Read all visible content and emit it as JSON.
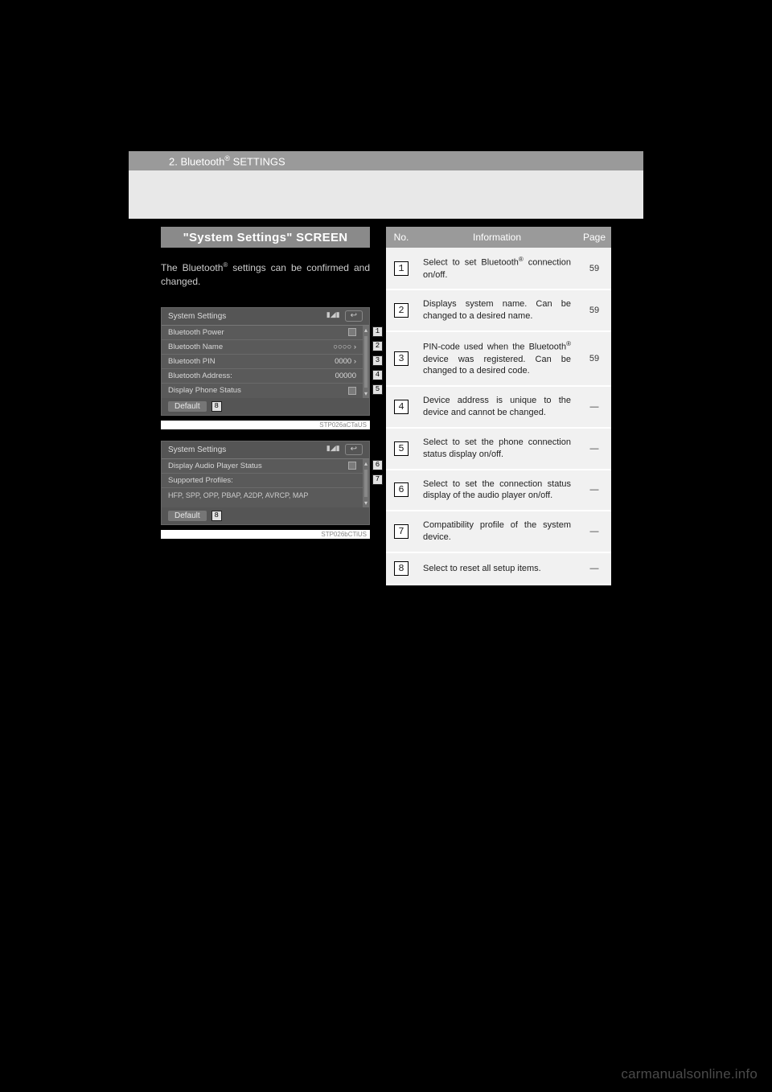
{
  "header": {
    "section": "2. Bluetooth",
    "reg": "®",
    "suffix": " SETTINGS"
  },
  "left": {
    "title": "\"System Settings\" SCREEN",
    "intro": "The Bluetooth® settings can be confirmed and changed.",
    "shot1": {
      "title": "System Settings",
      "rows": [
        {
          "label": "Bluetooth Power",
          "value": "",
          "check": true,
          "callout": "1"
        },
        {
          "label": "Bluetooth Name",
          "value": "○○○○ ›",
          "check": false,
          "callout": "2"
        },
        {
          "label": "Bluetooth PIN",
          "value": "0000 ›",
          "check": false,
          "callout": "3"
        },
        {
          "label": "Bluetooth Address:",
          "value": "00000",
          "check": false,
          "callout": "4"
        },
        {
          "label": "Display Phone Status",
          "value": "",
          "check": true,
          "callout": "5"
        }
      ],
      "default": "Default",
      "default_callout": "8",
      "code": "STP026aCTaUS"
    },
    "shot2": {
      "title": "System Settings",
      "rows": [
        {
          "label": "Display Audio Player Status",
          "value": "",
          "check": true,
          "callout": "6"
        },
        {
          "label": "Supported Profiles:",
          "value": "",
          "check": false,
          "callout": "7"
        }
      ],
      "profiles": "HFP, SPP, OPP, PBAP, A2DP, AVRCP, MAP",
      "default": "Default",
      "default_callout": "8",
      "code": "STP026bCTiUS"
    }
  },
  "table": {
    "head": {
      "no": "No.",
      "info": "Information",
      "page": "Page"
    },
    "rows": [
      {
        "no": "1",
        "info": "Select to set Bluetooth® connection on/off.",
        "page": "59"
      },
      {
        "no": "2",
        "info": "Displays system name. Can be changed to a desired name.",
        "page": "59"
      },
      {
        "no": "3",
        "info": "PIN-code used when the Bluetooth® device was registered. Can be changed to a desired code.",
        "page": "59"
      },
      {
        "no": "4",
        "info": "Device address is unique to the device and cannot be changed.",
        "page": "—"
      },
      {
        "no": "5",
        "info": "Select to set the phone connection status display on/off.",
        "page": "—"
      },
      {
        "no": "6",
        "info": "Select to set the connection status display of the audio player on/off.",
        "page": "—"
      },
      {
        "no": "7",
        "info": "Compatibility profile of the system device.",
        "page": "—"
      },
      {
        "no": "8",
        "info": "Select to reset all setup items.",
        "page": "—"
      }
    ]
  },
  "watermark": "carmanualsonline.info"
}
